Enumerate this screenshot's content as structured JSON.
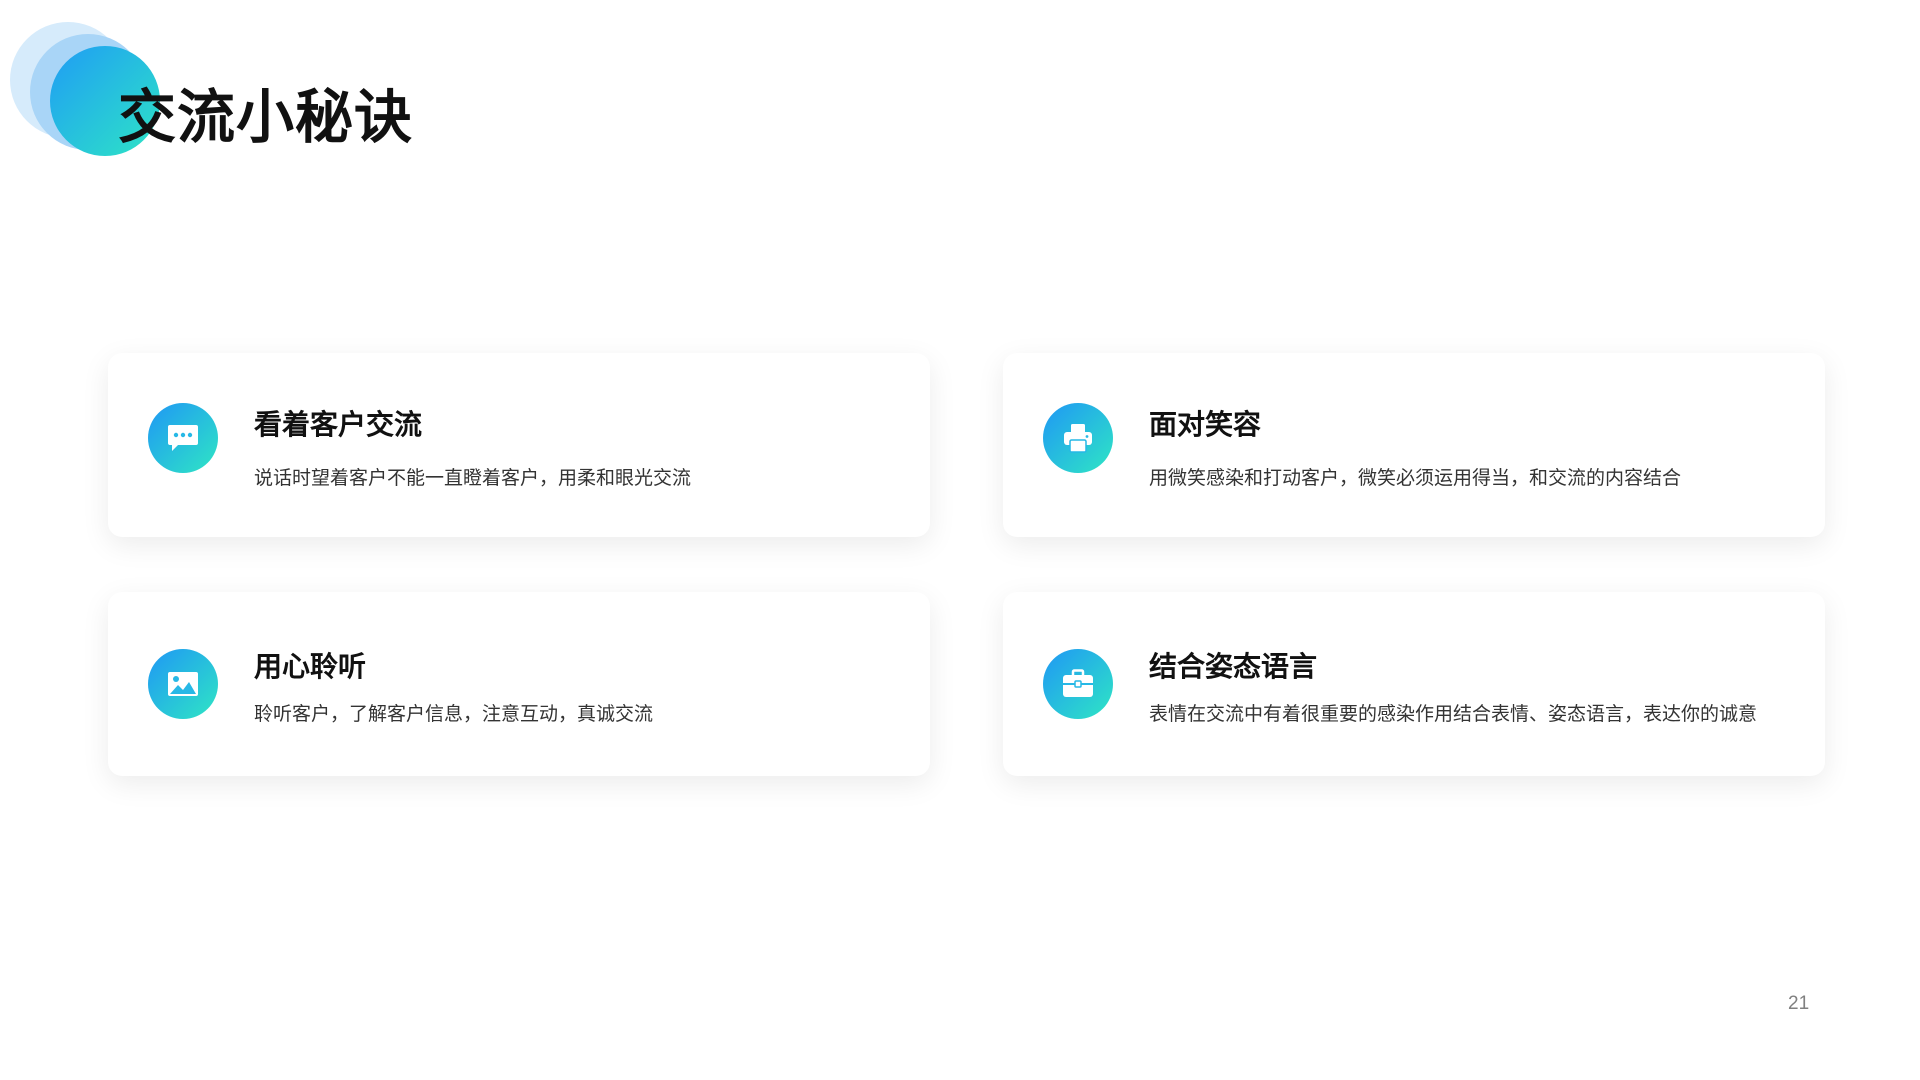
{
  "slide": {
    "title": "交流小秘诀",
    "page_number": "21",
    "accent_gradient": [
      "#1f97f5",
      "#2fe6c4"
    ],
    "cards": [
      {
        "title": "看着客户交流",
        "description": "说话时望着客户不能一直瞪着客户，用柔和眼光交流",
        "icon": "chat-bubble-icon"
      },
      {
        "title": "面对笑容",
        "description": "用微笑感染和打动客户，微笑必须运用得当，和交流的内容结合",
        "icon": "printer-icon"
      },
      {
        "title": "用心聆听",
        "description": "聆听客户，了解客户信息，注意互动，真诚交流",
        "icon": "image-icon"
      },
      {
        "title": "结合姿态语言",
        "description": "表情在交流中有着很重要的感染作用结合表情、姿态语言，表达你的诚意",
        "icon": "briefcase-icon"
      }
    ]
  }
}
